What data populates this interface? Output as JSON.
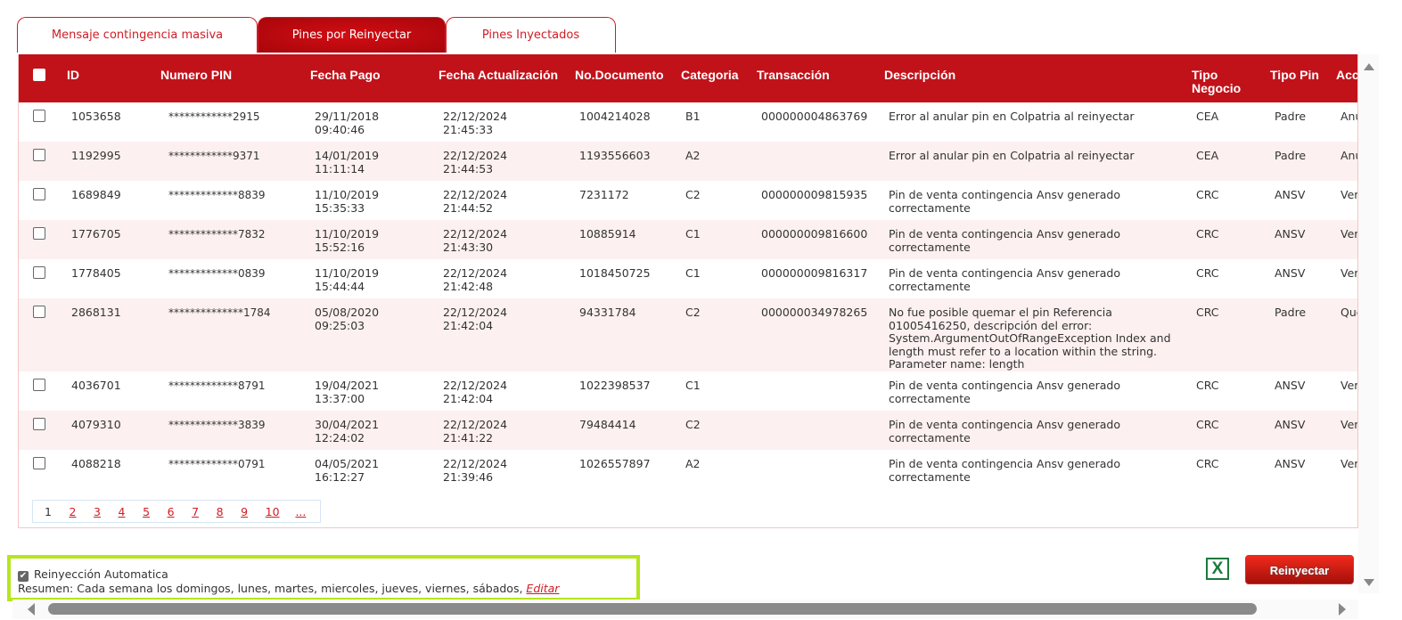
{
  "tabs": [
    {
      "label": "Mensaje contingencia masiva",
      "active": false
    },
    {
      "label": "Pines por Reinyectar",
      "active": true
    },
    {
      "label": "Pines Inyectados",
      "active": false
    }
  ],
  "table": {
    "headers": {
      "id": "ID",
      "pin": "Numero PIN",
      "fecha_pago": "Fecha Pago",
      "fecha_act": "Fecha Actualización",
      "doc": "No.Documento",
      "cat": "Categoria",
      "trans": "Transacción",
      "desc": "Descripción",
      "tipo_neg": "Tipo Negocio",
      "tipo_pin": "Tipo Pin",
      "acc": "Acc"
    },
    "rows": [
      {
        "id": "1053658",
        "pin": "************2915",
        "fecha_pago": "29/11/2018 09:40:46",
        "fecha_act": "22/12/2024 21:45:33",
        "doc": "1004214028",
        "cat": "B1",
        "trans": "000000004863769",
        "desc": "Error al anular pin en Colpatria al reinyectar",
        "tipo_neg": "CEA",
        "tipo_pin": "Padre",
        "acc": "Anu"
      },
      {
        "id": "1192995",
        "pin": "************9371",
        "fecha_pago": "14/01/2019 11:11:14",
        "fecha_act": "22/12/2024 21:44:53",
        "doc": "1193556603",
        "cat": "A2",
        "trans": "",
        "desc": "Error al anular pin en Colpatria al reinyectar",
        "tipo_neg": "CEA",
        "tipo_pin": "Padre",
        "acc": "Anu"
      },
      {
        "id": "1689849",
        "pin": "*************8839",
        "fecha_pago": "11/10/2019 15:35:33",
        "fecha_act": "22/12/2024 21:44:52",
        "doc": "7231172",
        "cat": "C2",
        "trans": "000000009815935",
        "desc": "Pin de venta contingencia Ansv generado correctamente",
        "tipo_neg": "CRC",
        "tipo_pin": "ANSV",
        "acc": "Ver"
      },
      {
        "id": "1776705",
        "pin": "*************7832",
        "fecha_pago": "11/10/2019 15:52:16",
        "fecha_act": "22/12/2024 21:43:30",
        "doc": "10885914",
        "cat": "C1",
        "trans": "000000009816600",
        "desc": "Pin de venta contingencia Ansv generado correctamente",
        "tipo_neg": "CRC",
        "tipo_pin": "ANSV",
        "acc": "Ver"
      },
      {
        "id": "1778405",
        "pin": "*************0839",
        "fecha_pago": "11/10/2019 15:44:44",
        "fecha_act": "22/12/2024 21:42:48",
        "doc": "1018450725",
        "cat": "C1",
        "trans": "000000009816317",
        "desc": "Pin de venta contingencia Ansv generado correctamente",
        "tipo_neg": "CRC",
        "tipo_pin": "ANSV",
        "acc": "Ver"
      },
      {
        "id": "2868131",
        "pin": "**************1784",
        "fecha_pago": "05/08/2020 09:25:03",
        "fecha_act": "22/12/2024 21:42:04",
        "doc": "94331784",
        "cat": "C2",
        "trans": "000000034978265",
        "desc": "No fue posible quemar el pin Referencia 01005416250, descripción del error: System.ArgumentOutOfRangeException Index and length must refer to a location within the string. Parameter name: length",
        "tipo_neg": "CRC",
        "tipo_pin": "Padre",
        "acc": "Que"
      },
      {
        "id": "4036701",
        "pin": "*************8791",
        "fecha_pago": "19/04/2021 13:37:00",
        "fecha_act": "22/12/2024 21:42:04",
        "doc": "1022398537",
        "cat": "C1",
        "trans": "",
        "desc": "Pin de venta contingencia Ansv generado correctamente",
        "tipo_neg": "CRC",
        "tipo_pin": "ANSV",
        "acc": "Ver"
      },
      {
        "id": "4079310",
        "pin": "*************3839",
        "fecha_pago": "30/04/2021 12:24:02",
        "fecha_act": "22/12/2024 21:41:22",
        "doc": "79484414",
        "cat": "C2",
        "trans": "",
        "desc": "Pin de venta contingencia Ansv generado correctamente",
        "tipo_neg": "CRC",
        "tipo_pin": "ANSV",
        "acc": "Ver"
      },
      {
        "id": "4088218",
        "pin": "*************0791",
        "fecha_pago": "04/05/2021 16:12:27",
        "fecha_act": "22/12/2024 21:39:46",
        "doc": "1026557897",
        "cat": "A2",
        "trans": "",
        "desc": "Pin de venta contingencia Ansv generado correctamente",
        "tipo_neg": "CRC",
        "tipo_pin": "ANSV",
        "acc": "Ver"
      }
    ]
  },
  "pager": {
    "current": "1",
    "pages": [
      "2",
      "3",
      "4",
      "5",
      "6",
      "7",
      "8",
      "9",
      "10",
      "..."
    ]
  },
  "auto": {
    "label": "Reinyección Automatica",
    "checked": true,
    "summary": "Resumen: Cada semana los domingos, lunes, martes, miercoles, jueves, viernes, sábados,",
    "edit": "Editar"
  },
  "excel_label": "X",
  "reinject_label": "Reinyectar"
}
